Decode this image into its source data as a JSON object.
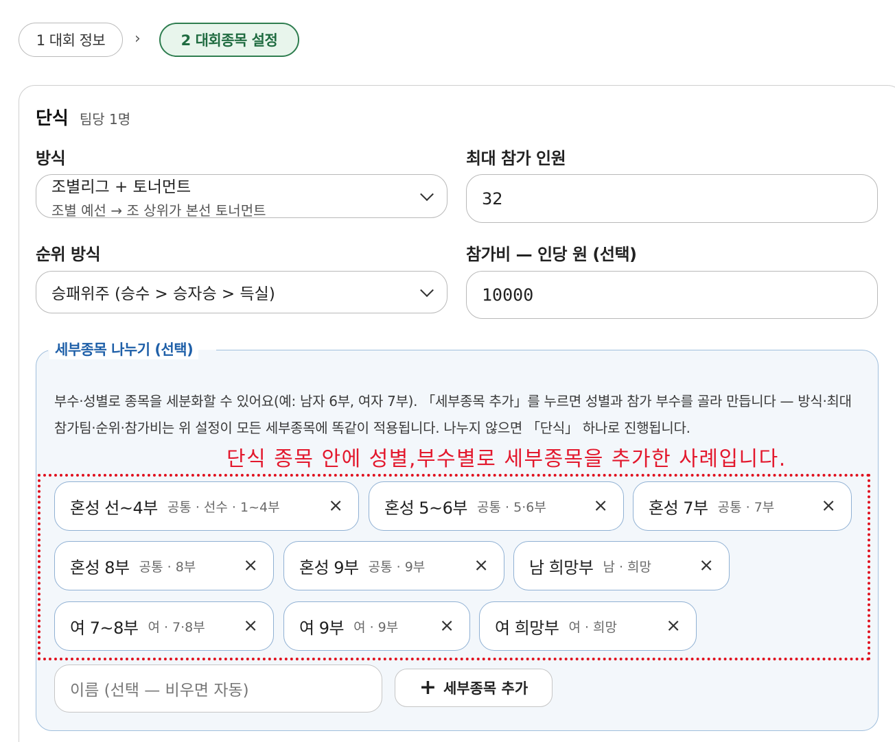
{
  "stepper": {
    "step1": "1 대회 정보",
    "separator": "›",
    "step2": "2 대회종목 설정"
  },
  "section": {
    "title": "단식",
    "subtitle": "팀당 1명"
  },
  "form": {
    "format_label": "방식",
    "format_value": "조별리그 + 토너먼트",
    "format_desc": "조별 예선 → 조 상위가 본선 토너먼트",
    "max_label": "최대 참가 인원",
    "max_value": "32",
    "rank_label": "순위 방식",
    "rank_value": "승패위주 (승수 > 승자승 > 득실)",
    "fee_label": "참가비 — 인당 원 (선택)",
    "fee_value": "10000"
  },
  "subdivision": {
    "legend": "세부종목 나누기 (선택)",
    "description": "부수·성별로 종목을 세분화할 수 있어요(예: 남자 6부, 여자 7부). 「세부종목 추가」를 누르면 성별과 참가 부수를 골라 만듭니다 — 방식·최대 참가팀·순위·참가비는 위 설정이 모든 세부종목에 똑같이 적용됩니다. 나누지 않으면 「단식」 하나로 진행됩니다.",
    "annotation": "단식 종목 안에 성별,부수별로 세부종목을 추가한 사례입니다.",
    "chips": [
      {
        "name": "혼성 선~4부",
        "meta": "공통 · 선수 · 1~4부"
      },
      {
        "name": "혼성 5~6부",
        "meta": "공통 · 5·6부"
      },
      {
        "name": "혼성 7부",
        "meta": "공통 · 7부"
      },
      {
        "name": "혼성 8부",
        "meta": "공통 · 8부"
      },
      {
        "name": "혼성 9부",
        "meta": "공통 · 9부"
      },
      {
        "name": "남 희망부",
        "meta": "남 · 희망"
      },
      {
        "name": "여 7~8부",
        "meta": "여 · 7·8부"
      },
      {
        "name": "여 9부",
        "meta": "여 · 9부"
      },
      {
        "name": "여 희망부",
        "meta": "여 · 희망"
      }
    ],
    "remove_symbol": "×",
    "name_placeholder": "이름 (선택 — 비우면 자동)",
    "add_button": "세부종목 추가",
    "add_symbol": "+"
  },
  "colors": {
    "accent_green": "#2e7d4f",
    "accent_blue": "#1e5fa8",
    "annotation_red": "#e3182d"
  }
}
